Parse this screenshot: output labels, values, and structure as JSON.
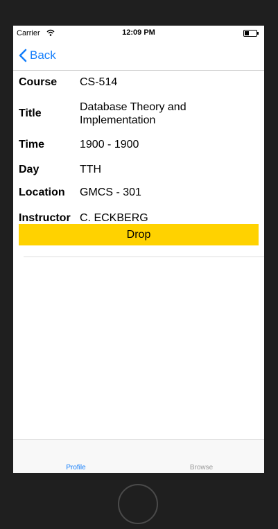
{
  "status_bar": {
    "carrier": "Carrier",
    "time": "12:09 PM"
  },
  "nav": {
    "back_label": "Back"
  },
  "course": {
    "fields": [
      {
        "label": "Course",
        "value": "CS-514"
      },
      {
        "label": "Title",
        "value": "Database Theory and Implementation"
      },
      {
        "label": "Time",
        "value": "1900 - 1900"
      },
      {
        "label": "Day",
        "value": "TTH"
      },
      {
        "label": "Location",
        "value": "GMCS - 301"
      },
      {
        "label": "Instructor",
        "value": "C. ECKBERG"
      }
    ],
    "drop_label": "Drop"
  },
  "tabs": [
    {
      "label": "Profile",
      "active": true
    },
    {
      "label": "Browse",
      "active": false
    }
  ],
  "colors": {
    "accent": "#147efb",
    "drop_button": "#ffd200"
  }
}
